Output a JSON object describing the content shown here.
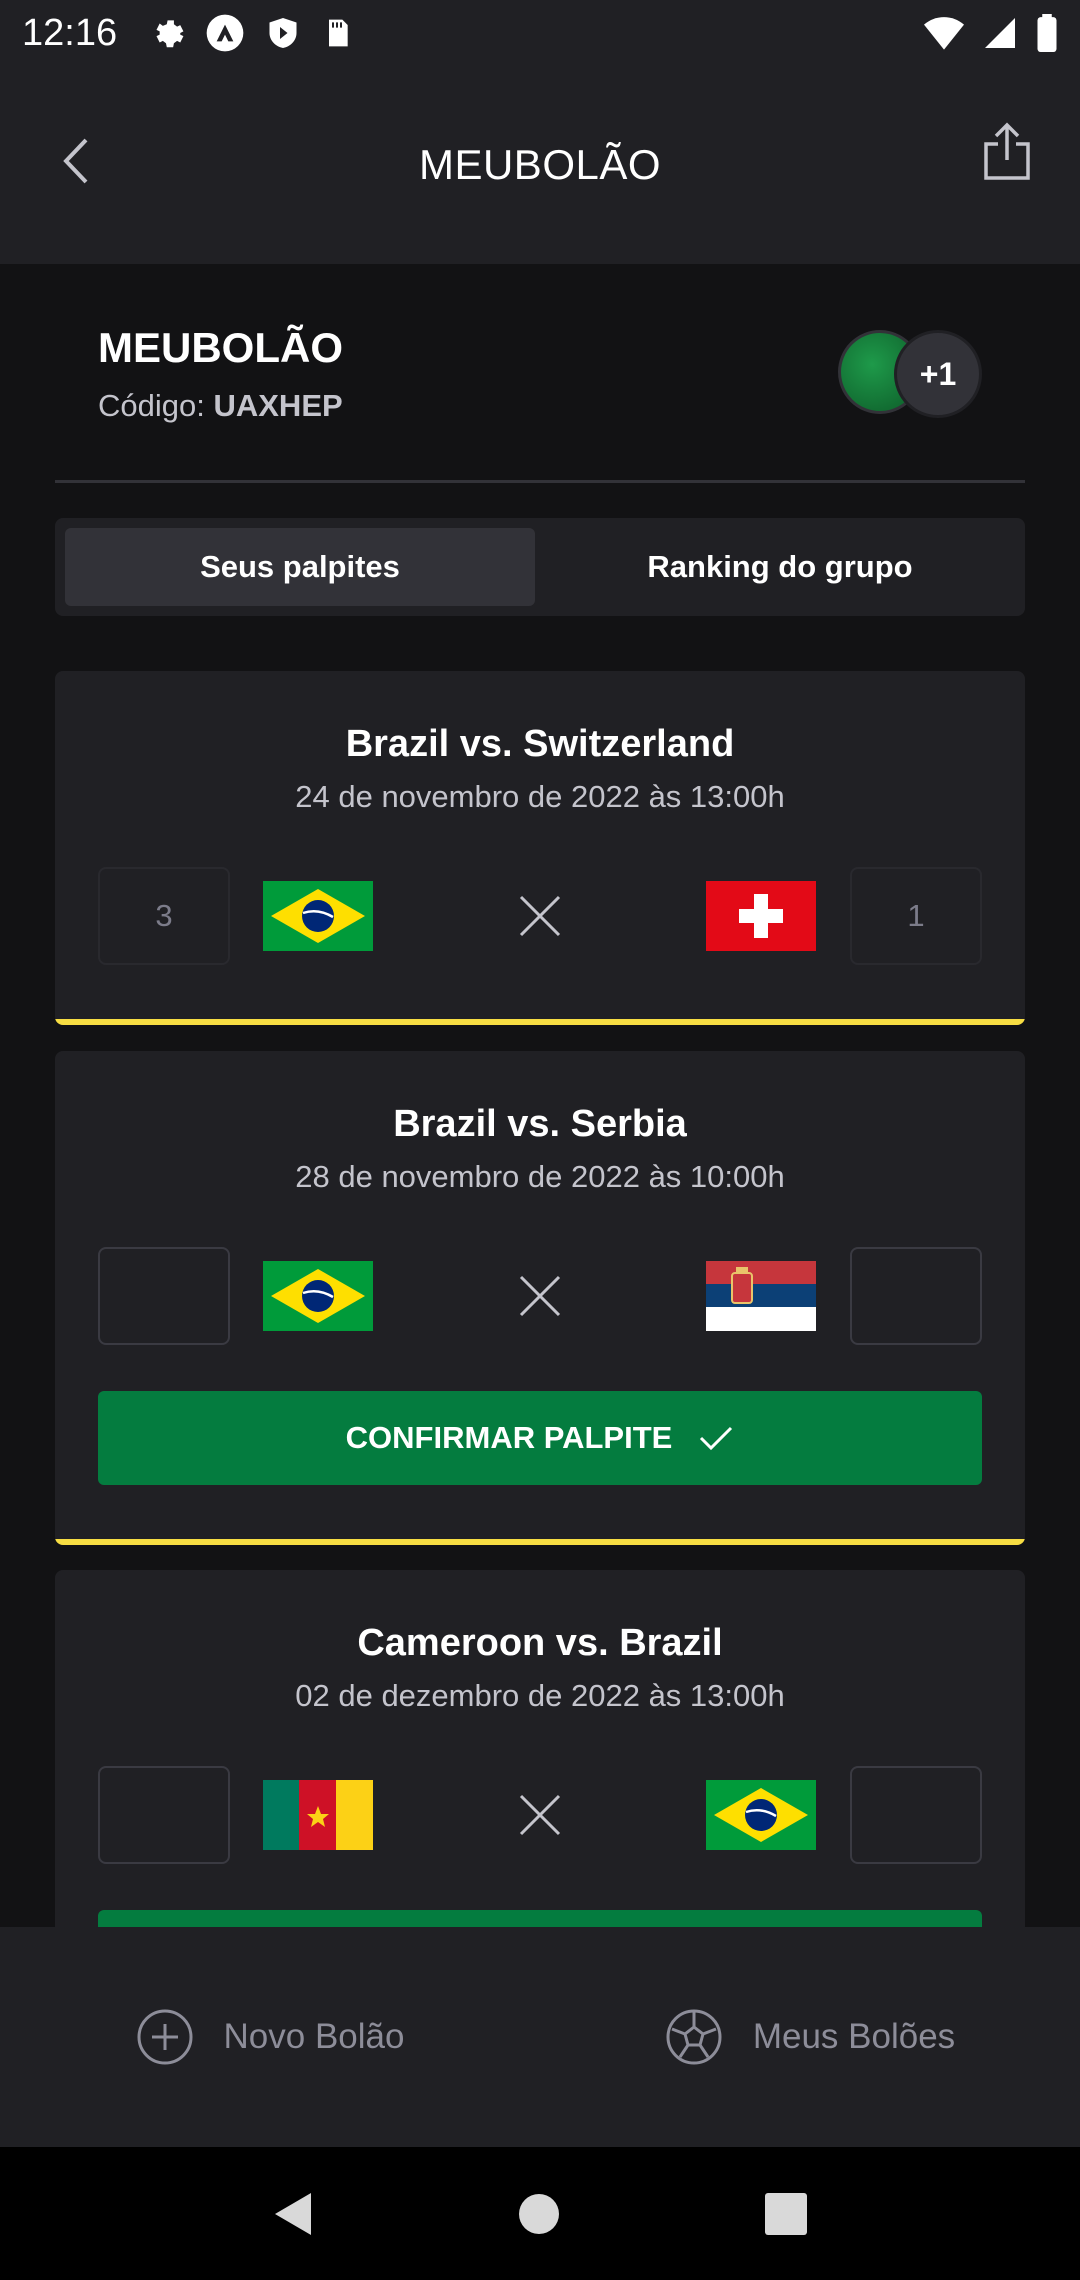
{
  "status_bar": {
    "time": "12:16"
  },
  "header": {
    "title": "MEUBOLÃO"
  },
  "pool": {
    "name": "MEUBOLÃO",
    "code_label": "Código:",
    "code_value": "UAXHEP",
    "extra_members": "+1"
  },
  "tabs": [
    {
      "label": "Seus palpites",
      "active": true
    },
    {
      "label": "Ranking do grupo",
      "active": false
    }
  ],
  "matches": [
    {
      "title": "Brazil vs. Switzerland",
      "date": "24 de novembro de 2022 às 13:00h",
      "home_flag": "brazil-flag",
      "away_flag": "switzerland-flag",
      "home_score": "3",
      "away_score": "1"
    },
    {
      "title": "Brazil vs. Serbia",
      "date": "28 de novembro de 2022 às 10:00h",
      "home_flag": "brazil-flag",
      "away_flag": "serbia-flag",
      "home_score": "",
      "away_score": "",
      "confirm_label": "CONFIRMAR PALPITE"
    },
    {
      "title": "Cameroon vs. Brazil",
      "date": "02 de dezembro de 2022 às 13:00h",
      "home_flag": "cameroon-flag",
      "away_flag": "brazil-flag",
      "home_score": "",
      "away_score": ""
    }
  ],
  "bottom_nav": [
    {
      "label": "Novo Bolão",
      "icon": "plus-circle-icon"
    },
    {
      "label": "Meus Bolões",
      "icon": "soccer-ball-icon"
    }
  ],
  "colors": {
    "accent_green": "#047c3f",
    "accent_yellow": "#f7dd43",
    "background": "#121214",
    "surface": "#202024"
  }
}
